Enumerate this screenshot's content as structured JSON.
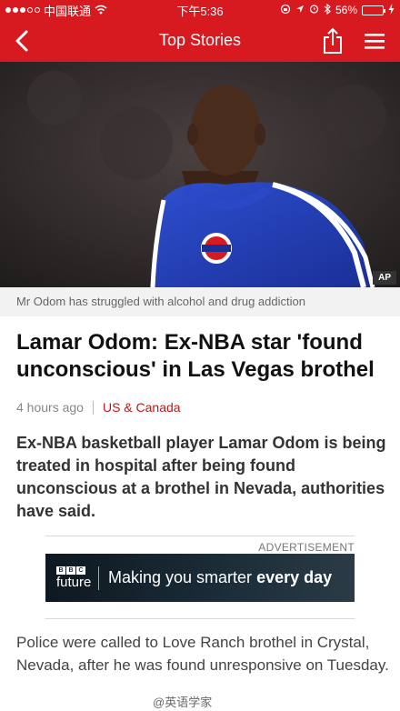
{
  "status_bar": {
    "carrier": "中国联通",
    "time": "下午5:36",
    "battery_percent": "56%",
    "battery_level": 0.56,
    "icons": [
      "signal-dots",
      "wifi-icon",
      "lock-rotation-icon",
      "location-arrow-icon",
      "alarm-icon",
      "bluetooth-icon",
      "battery-icon",
      "charging-bolt-icon"
    ]
  },
  "nav": {
    "title": "Top Stories",
    "back_icon": "chevron-left-icon",
    "share_icon": "share-icon",
    "menu_icon": "hamburger-menu-icon"
  },
  "hero": {
    "credit": "AP",
    "caption": "Mr Odom has struggled with alcohol and drug addiction"
  },
  "article": {
    "headline": "Lamar Odom: Ex-NBA star 'found unconscious' in Las Vegas brothel",
    "timestamp": "4 hours ago",
    "section": "US & Canada",
    "intro": "Ex-NBA basketball player Lamar Odom is being treated in hospital after being found unconscious at a brothel in Nevada, authorities have said.",
    "body": "Police were called to Love Ranch brothel in Crystal, Nevada, after he was found unresponsive on Tuesday."
  },
  "advertisement": {
    "label": "ADVERTISEMENT",
    "brand_letters": [
      "B",
      "B",
      "C"
    ],
    "brand_name": "future",
    "tagline_regular": "Making you smarter ",
    "tagline_bold": "every day"
  },
  "watermark": "@英语学家",
  "colors": {
    "brand_red": "#d71920",
    "section_link": "#bb1919",
    "caption_bg": "#f2f2f2"
  }
}
